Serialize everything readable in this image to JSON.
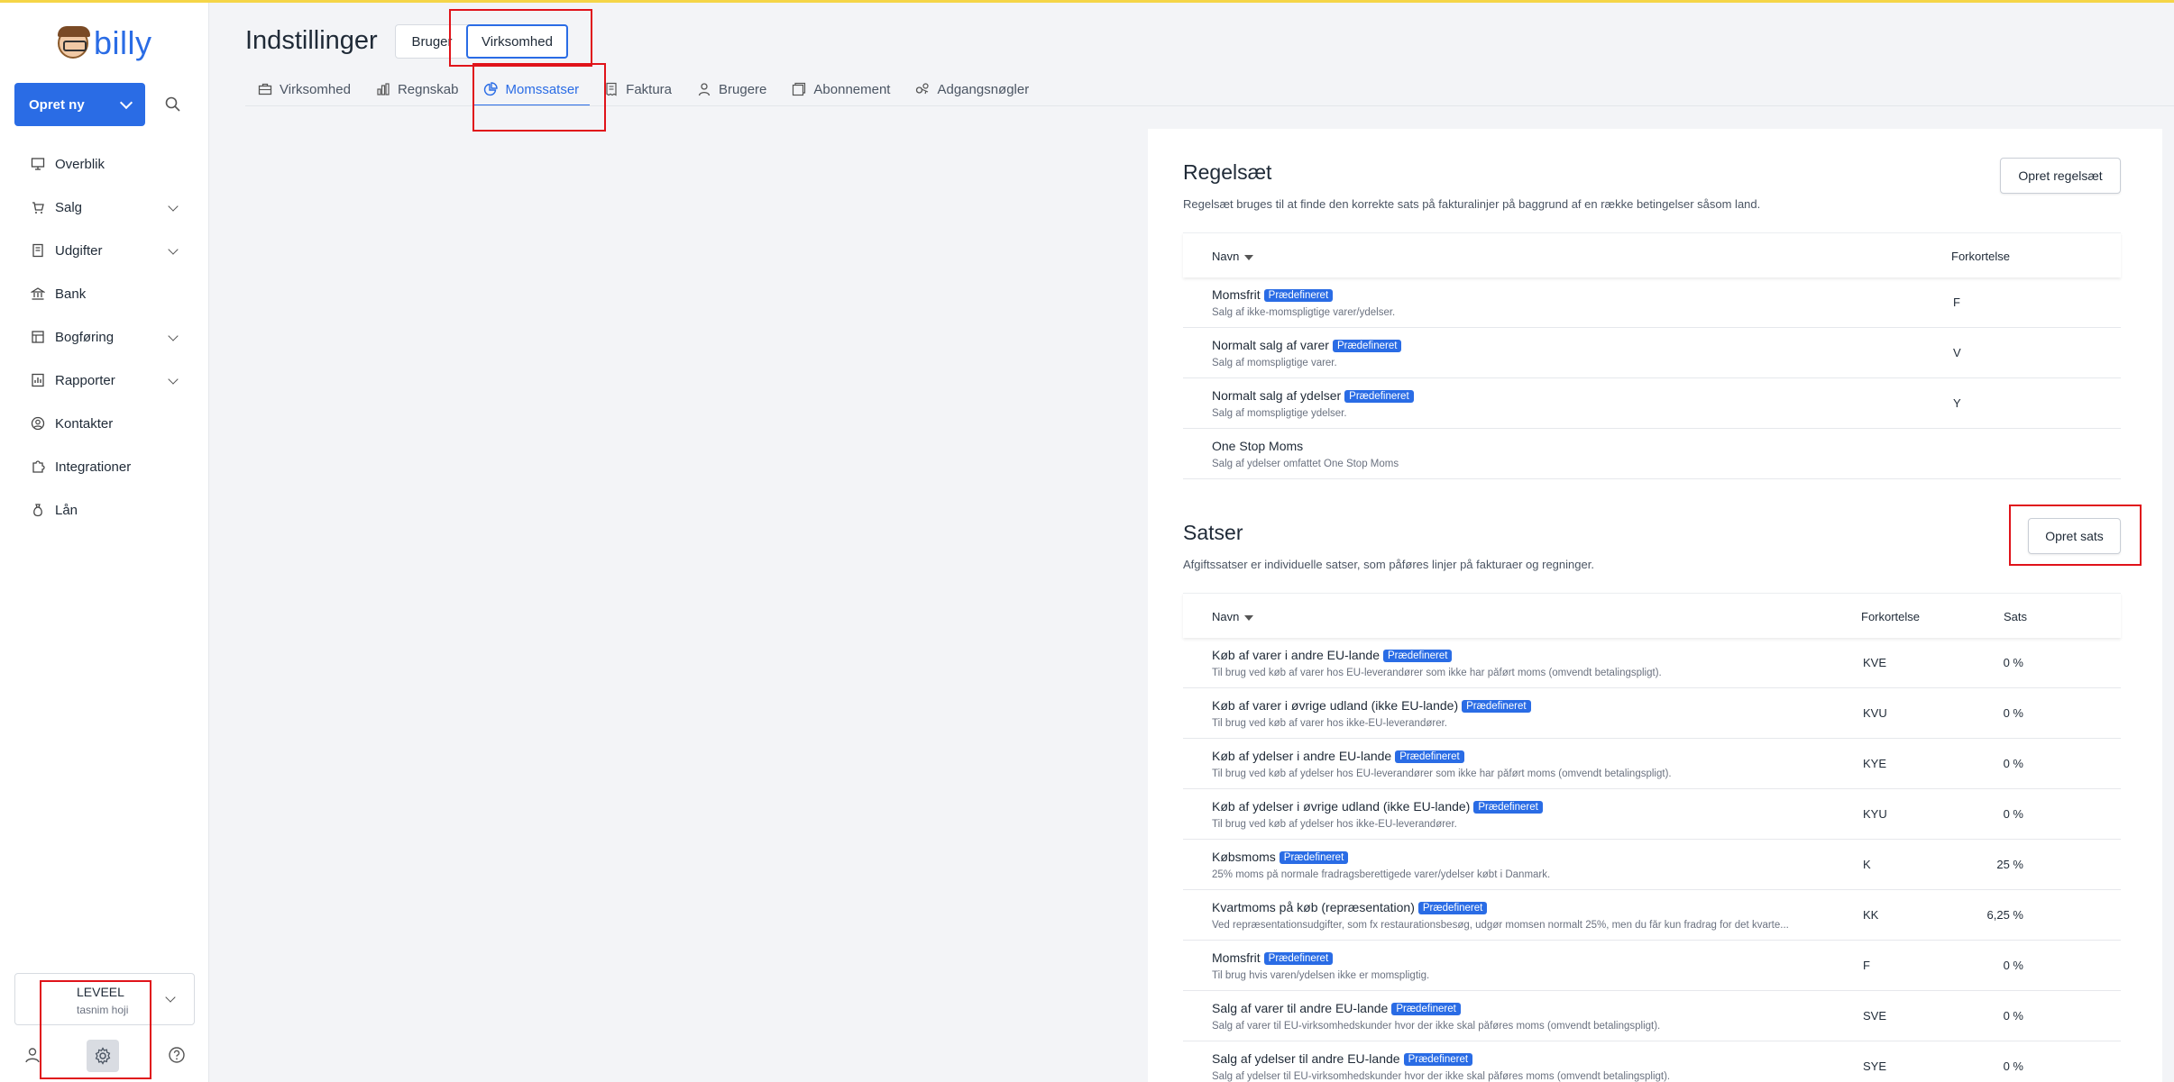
{
  "brand": {
    "name": "billy"
  },
  "sidebar": {
    "create_label": "Opret ny",
    "items": [
      {
        "label": "Overblik",
        "has_children": false
      },
      {
        "label": "Salg",
        "has_children": true
      },
      {
        "label": "Udgifter",
        "has_children": true
      },
      {
        "label": "Bank",
        "has_children": false
      },
      {
        "label": "Bogføring",
        "has_children": true
      },
      {
        "label": "Rapporter",
        "has_children": true
      },
      {
        "label": "Kontakter",
        "has_children": false
      },
      {
        "label": "Integrationer",
        "has_children": false
      },
      {
        "label": "Lån",
        "has_children": false
      }
    ],
    "company": "LEVEEL",
    "user": "tasnim hoji"
  },
  "header": {
    "title": "Indstillinger",
    "segment_bruger": "Bruger",
    "segment_virksomhed": "Virksomhed"
  },
  "tabs": [
    {
      "label": "Virksomhed",
      "icon": "briefcase-icon",
      "active": false
    },
    {
      "label": "Regnskab",
      "icon": "bar-chart-icon",
      "active": false
    },
    {
      "label": "Momssatser",
      "icon": "pie-chart-icon",
      "active": true
    },
    {
      "label": "Faktura",
      "icon": "invoice-icon",
      "active": false
    },
    {
      "label": "Brugere",
      "icon": "user-icon",
      "active": false
    },
    {
      "label": "Abonnement",
      "icon": "subscription-icon",
      "active": false
    },
    {
      "label": "Adgangsnøgler",
      "icon": "keys-icon",
      "active": false
    }
  ],
  "rulesets": {
    "title": "Regelsæt",
    "description": "Regelsæt bruges til at finde den korrekte sats på fakturalinjer på baggrund af en række betingelser såsom land.",
    "create_label": "Opret regelsæt",
    "col_name": "Navn",
    "col_abbr": "Forkortelse",
    "badge": "Prædefineret",
    "rows": [
      {
        "name": "Momsfrit",
        "predefined": true,
        "desc": "Salg af ikke-momspligtige varer/ydelser.",
        "abbr": "F"
      },
      {
        "name": "Normalt salg af varer",
        "predefined": true,
        "desc": "Salg af momspligtige varer.",
        "abbr": "V"
      },
      {
        "name": "Normalt salg af ydelser",
        "predefined": true,
        "desc": "Salg af momspligtige ydelser.",
        "abbr": "Y"
      },
      {
        "name": "One Stop Moms",
        "predefined": false,
        "desc": "Salg af ydelser omfattet One Stop Moms",
        "abbr": ""
      }
    ]
  },
  "rates": {
    "title": "Satser",
    "description": "Afgiftssatser er individuelle satser, som påføres linjer på fakturaer og regninger.",
    "create_label": "Opret sats",
    "col_name": "Navn",
    "col_abbr": "Forkortelse",
    "col_rate": "Sats",
    "badge": "Prædefineret",
    "rows": [
      {
        "name": "Køb af varer i andre EU-lande",
        "predefined": true,
        "desc": "Til brug ved køb af varer hos EU-leverandører som ikke har påført moms (omvendt betalingspligt).",
        "abbr": "KVE",
        "rate": "0 %"
      },
      {
        "name": "Køb af varer i øvrige udland (ikke EU-lande)",
        "predefined": true,
        "desc": "Til brug ved køb af varer hos ikke-EU-leverandører.",
        "abbr": "KVU",
        "rate": "0 %"
      },
      {
        "name": "Køb af ydelser i andre EU-lande",
        "predefined": true,
        "desc": "Til brug ved køb af ydelser hos EU-leverandører som ikke har påført moms (omvendt betalingspligt).",
        "abbr": "KYE",
        "rate": "0 %"
      },
      {
        "name": "Køb af ydelser i øvrige udland (ikke EU-lande)",
        "predefined": true,
        "desc": "Til brug ved køb af ydelser hos ikke-EU-leverandører.",
        "abbr": "KYU",
        "rate": "0 %"
      },
      {
        "name": "Købsmoms",
        "predefined": true,
        "desc": "25% moms på normale fradragsberettigede varer/ydelser købt i Danmark.",
        "abbr": "K",
        "rate": "25 %"
      },
      {
        "name": "Kvartmoms på køb (repræsentation)",
        "predefined": true,
        "desc": "Ved repræsentationsudgifter, som fx restaurationsbesøg, udgør momsen normalt 25%, men du får kun fradrag for det kvarte...",
        "abbr": "KK",
        "rate": "6,25 %"
      },
      {
        "name": "Momsfrit",
        "predefined": true,
        "desc": "Til brug hvis varen/ydelsen ikke er momspligtig.",
        "abbr": "F",
        "rate": "0 %"
      },
      {
        "name": "Salg af varer til andre EU-lande",
        "predefined": true,
        "desc": "Salg af varer til EU-virksomhedskunder hvor der ikke skal påføres moms (omvendt betalingspligt).",
        "abbr": "SVE",
        "rate": "0 %"
      },
      {
        "name": "Salg af ydelser til andre EU-lande",
        "predefined": true,
        "desc": "Salg af ydelser til EU-virksomhedskunder hvor der ikke skal påføres moms (omvendt betalingspligt).",
        "abbr": "SYE",
        "rate": "0 %"
      }
    ]
  },
  "colors": {
    "accent": "#2a6ce5",
    "annotation": "#e0131a",
    "topline": "#f5d547"
  }
}
